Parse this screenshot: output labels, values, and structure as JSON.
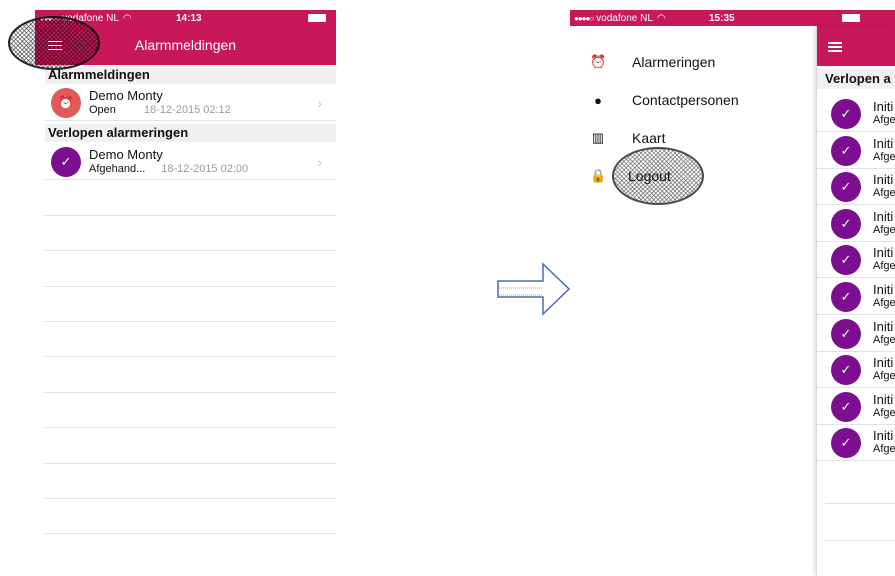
{
  "left_phone": {
    "status": {
      "carrier": "vodafone NL",
      "time": "14:13"
    },
    "header_title": "Alarmmeldingen",
    "section_alarms": "Alarmmeldingen",
    "alarm_row": {
      "name": "Demo Monty",
      "status": "Open",
      "date": "18-12-2015 02:12"
    },
    "section_expired": "Verlopen alarmeringen",
    "expired_row": {
      "name": "Demo Monty",
      "status": "Afgehand...",
      "date": "18-12-2015 02:00"
    }
  },
  "right_phone": {
    "status": {
      "carrier": "vodafone NL",
      "time": "15:35"
    },
    "menu": {
      "alarms": "Alarmeringen",
      "contacts": "Contactpersonen",
      "map": "Kaart",
      "logout": "Logout"
    },
    "section_partial": "Verlopen a",
    "row_title_partial": "Initi",
    "row_sub_partial": "Afge"
  },
  "icons": [
    "menu-icon",
    "alarm-clock-icon",
    "user-icon",
    "map-icon",
    "lock-icon",
    "check-icon",
    "chevron-right-icon",
    "wifi-icon",
    "battery-icon",
    "arrow-right-icon"
  ],
  "colors": {
    "brand_pink": "#c8185a",
    "purple": "#7b0f8f",
    "alarm_red": "#e05a5a"
  }
}
